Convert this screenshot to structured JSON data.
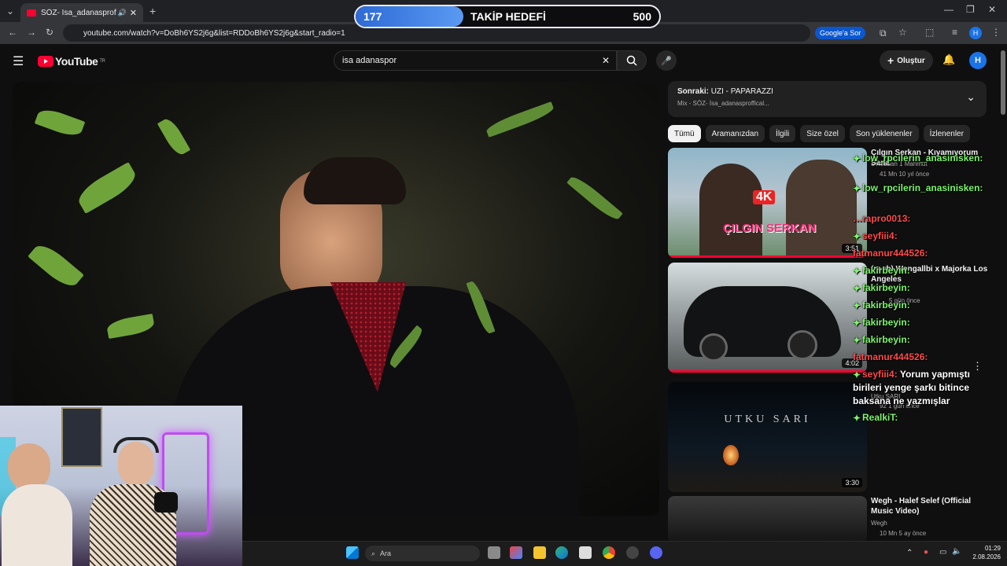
{
  "browser": {
    "tab_title": "SÖZ- İsa_adanasproffical...",
    "url": "youtube.com/watch?v=DoBh6YS2j6g&list=RDDoBh6YS2j6g&start_radio=1",
    "google_button": "Google'a Sor",
    "profile_initial": "H"
  },
  "goal": {
    "current": "177",
    "label": "TAKİP HEDEFİ",
    "target": "500",
    "progress": 0.354
  },
  "youtube": {
    "logo_text": "YouTube",
    "logo_region": "TR",
    "search_value": "isa adanaspor",
    "create_label": "Oluştur",
    "avatar_initial": "H"
  },
  "next_box": {
    "prefix": "Sonraki:",
    "title": "UZI - PAPARAZZI",
    "subtitle": "Mix - SÖZ- İsa_adanasproffical..."
  },
  "chips": [
    "Tümü",
    "Aramanızdan",
    "İlgili",
    "Size özel",
    "Son yüklenenler",
    "İzlenenler"
  ],
  "videos": [
    {
      "title": "Çılgın Serkan - Kıyamıyorum Sana",
      "channel": "1 Kezban 1 Mahmut",
      "meta": "41 Mn  10 yıl önce",
      "duration": "3:51",
      "thumb_text": "ÇILGIN SERKAN",
      "thumb_badge": "4K"
    },
    {
      "title": "(re rb) Wengallbi x Majorka Los Angeles",
      "channel": "",
      "meta": "5 gün önce",
      "duration": "4:02"
    },
    {
      "title": "",
      "channel": "Utku SARI",
      "meta": "92  1 gün önce",
      "duration": "3:30",
      "thumb_text": "UTKU SARI"
    },
    {
      "title": "Wegh - Halef Selef (Official Music Video)",
      "channel": "Wegh",
      "meta": "10 Mn  5 ay önce",
      "duration": ""
    }
  ],
  "chat": [
    {
      "user": "low_rpcilerin_anasinisken:",
      "msg": "",
      "color": "#7cf56b"
    },
    {
      "user": "low_rpcilerin_anasinisken:",
      "msg": "",
      "color": "#7cf56b"
    },
    {
      "user": "…rapro0013:",
      "msg": "",
      "color": "#ff4b4b"
    },
    {
      "user": "seyfiii4:",
      "msg": "",
      "color": "#ff4b4b"
    },
    {
      "user": "fatmanur444526:",
      "msg": "",
      "color": "#ff4b4b"
    },
    {
      "user": "fakirbeyin:",
      "msg": "",
      "color": "#7cf56b"
    },
    {
      "user": "fakirbeyin:",
      "msg": "",
      "color": "#7cf56b"
    },
    {
      "user": "fakirbeyin:",
      "msg": "",
      "color": "#7cf56b"
    },
    {
      "user": "fakirbeyin:",
      "msg": "",
      "color": "#7cf56b"
    },
    {
      "user": "fakirbeyin:",
      "msg": "",
      "color": "#7cf56b"
    },
    {
      "user": "fatmanur444526:",
      "msg": "",
      "color": "#ff4b4b"
    },
    {
      "user": "seyfiii4:",
      "msg": "Yorum yapmıştı",
      "color": "#ff4b4b"
    },
    {
      "user": "",
      "msg": "birileri yenge şarkı bitince",
      "color": "#ffffff"
    },
    {
      "user": "",
      "msg": "baksana ne yazmışlar",
      "color": "#ffffff"
    },
    {
      "user": "RealkiT:",
      "msg": "",
      "color": "#7cf56b"
    }
  ],
  "taskbar": {
    "search_label": "Ara",
    "time": "01:29",
    "date": "2.08.2026"
  }
}
